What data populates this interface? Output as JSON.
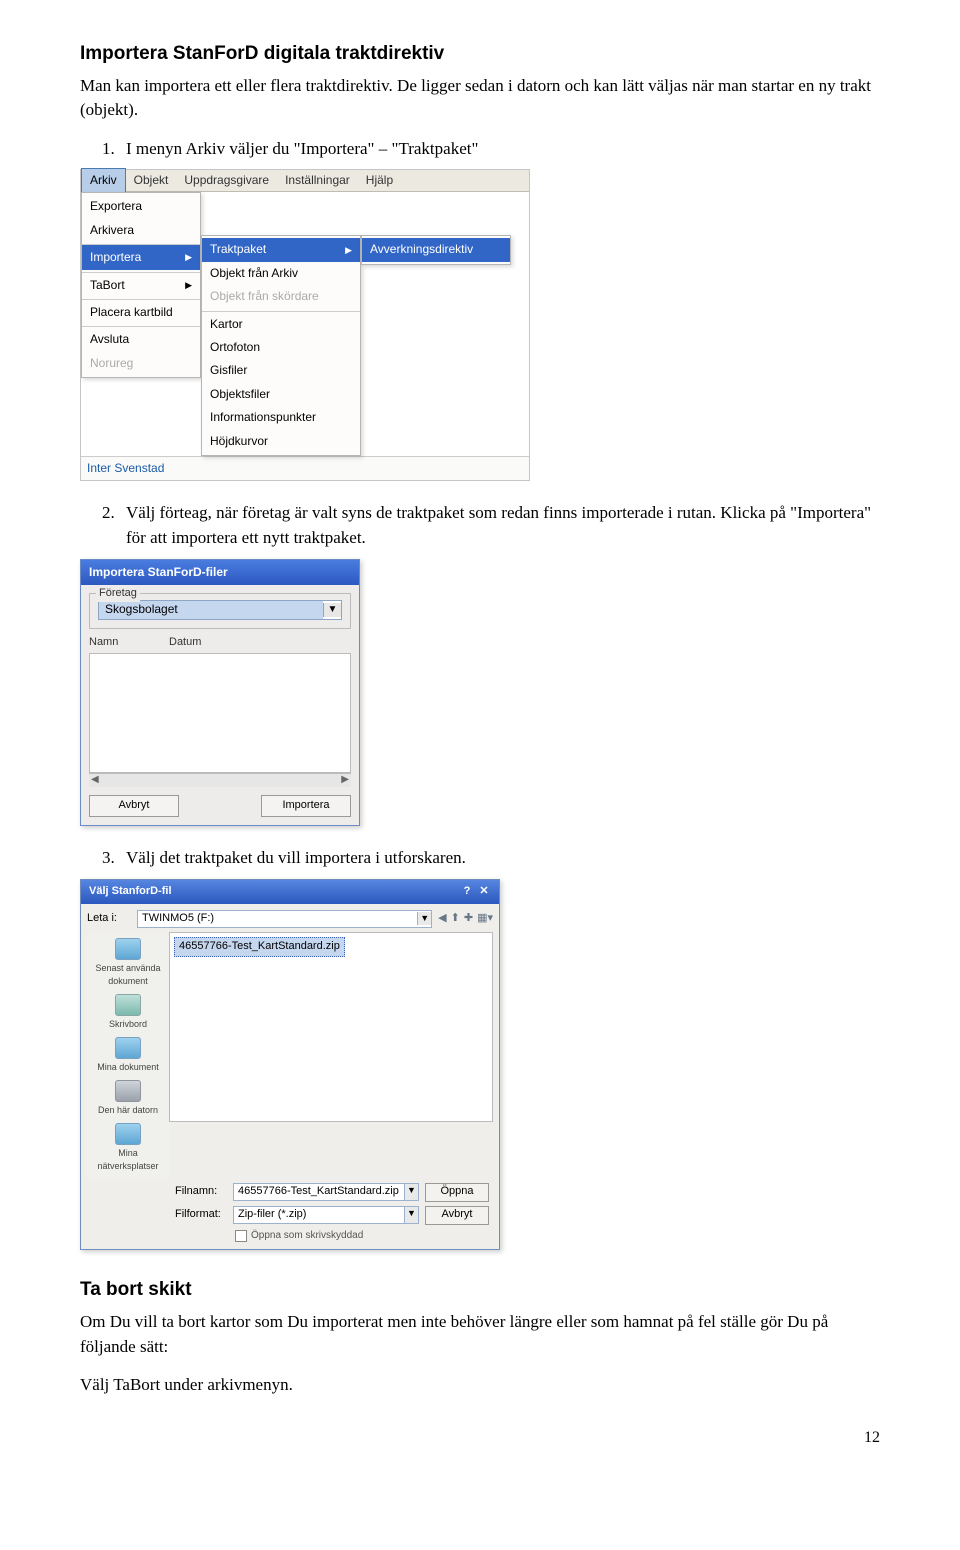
{
  "section1": {
    "title": "Importera StanForD digitala traktdirektiv",
    "intro": "Man kan importera ett eller flera traktdirektiv. De ligger sedan i datorn och kan lätt väljas när man startar en ny trakt (objekt).",
    "step1": "I menyn Arkiv väljer du \"Importera\" – \"Traktpaket\"",
    "step2": "Välj förteag, när företag är valt syns de traktpaket som redan finns importerade i rutan. Klicka på \"Importera\" för att importera ett nytt traktpaket.",
    "step3": "Välj det traktpaket du vill importera i utforskaren."
  },
  "section2": {
    "title": "Ta bort skikt",
    "para1": "Om Du vill ta bort kartor som Du importerat men inte behöver längre eller som hamnat på fel ställe gör Du på följande sätt:",
    "para2": "Välj TaBort under arkivmenyn."
  },
  "pageNumber": "12",
  "fig1": {
    "menubar": {
      "arkiv": "Arkiv",
      "objekt": "Objekt",
      "uppdragsgivare": "Uppdragsgivare",
      "installningar": "Inställningar",
      "hjalp": "Hjälp"
    },
    "menu1": {
      "exportera": "Exportera",
      "arkivera": "Arkivera",
      "importera": "Importera",
      "tabort": "TaBort",
      "placera": "Placera kartbild",
      "avsluta": "Avsluta",
      "noraraj": "Norureg"
    },
    "menu2": {
      "traktpaket": "Traktpaket",
      "obj_arkiv": "Objekt från Arkiv",
      "obj_skordare": "Objekt från skördare",
      "kartor": "Kartor",
      "ortofoton": "Ortofoton",
      "gisfiler": "Gisfiler",
      "objektsfiler": "Objektsfiler",
      "infopunkter": "Informationspunkter",
      "hojdkurvor": "Höjdkurvor"
    },
    "menu3": {
      "avverk": "Avverkningsdirektiv"
    },
    "footer": "Inter  Svenstad"
  },
  "fig2": {
    "title": "Importera StanForD-filer",
    "grp_foretag": "Företag",
    "foretag_value": "Skogsbolaget",
    "col_namn": "Namn",
    "col_datum": "Datum",
    "btn_avbryt": "Avbryt",
    "btn_importera": "Importera"
  },
  "fig3": {
    "title": "Välj StanforD-fil",
    "leta": "Leta i:",
    "drive": "TWINMO5 (F:)",
    "file_sel": "46557766-Test_KartStandard.zip",
    "sb_recent": "Senast använda dokument",
    "sb_desktop": "Skrivbord",
    "sb_mydocs": "Mina dokument",
    "sb_mycomp": "Den här datorn",
    "sb_network": "Mina nätverksplatser",
    "lbl_filnamn": "Filnamn:",
    "val_filnamn": "46557766-Test_KartStandard.zip",
    "lbl_filformat": "Filformat:",
    "val_filformat": "Zip-filer (*.zip)",
    "btn_open": "Öppna",
    "btn_cancel": "Avbryt",
    "chk_readonly": "Öppna som skrivskyddad"
  }
}
